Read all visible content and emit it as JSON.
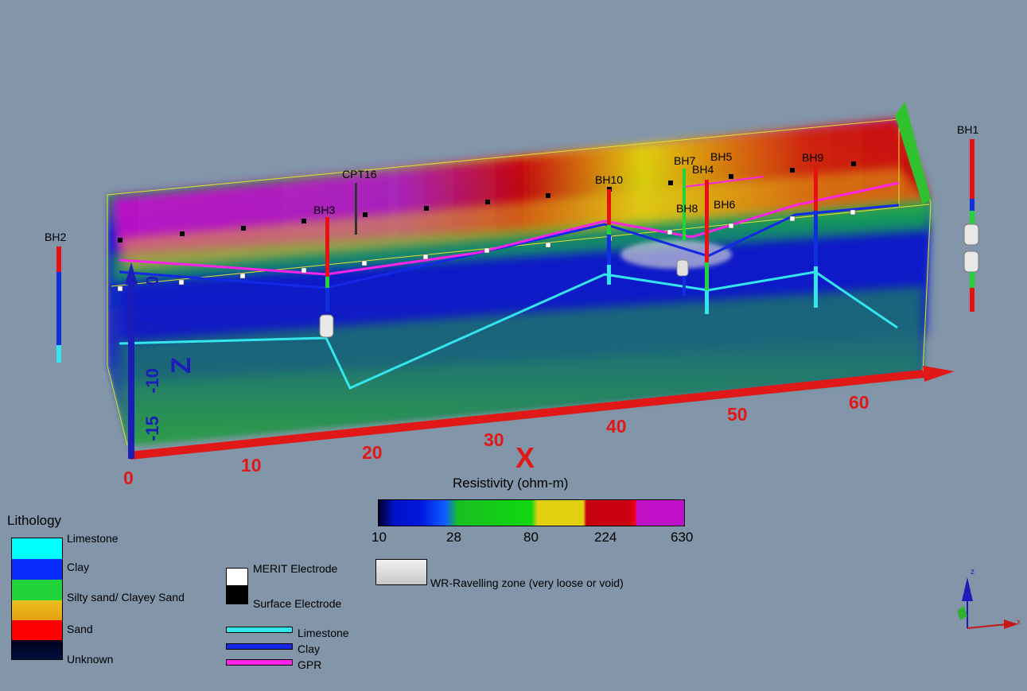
{
  "scene": {
    "boreholes": [
      "BH1",
      "BH2",
      "BH3",
      "BH4",
      "BH5",
      "BH6",
      "BH7",
      "BH8",
      "BH9",
      "BH10",
      "CPT16"
    ],
    "x_axis": {
      "title": "X",
      "ticks": [
        "0",
        "10",
        "20",
        "30",
        "40",
        "50",
        "60"
      ]
    },
    "z_axis": {
      "title": "Z",
      "ticks": [
        "0",
        "-5",
        "-10",
        "-15"
      ]
    },
    "triad": {
      "x": "x",
      "z": "z"
    },
    "colors": {
      "limestone": "#33e6ee",
      "clay": "#1428e6",
      "gpr": "#ff22e8",
      "x_axis": "#e01818",
      "z_axis": "#1c1cb8"
    }
  },
  "resistivity": {
    "title": "Resistivity (ohm-m)",
    "ticks": [
      "10",
      "28",
      "80",
      "224",
      "630"
    ],
    "colors": [
      "#00002a",
      "#0012c8",
      "#1060ff",
      "#18c020",
      "#10d810",
      "#e0d010",
      "#c80010",
      "#ee0010",
      "#c010c8"
    ]
  },
  "lithology": {
    "title": "Lithology",
    "items": [
      {
        "label": "Limestone",
        "color": "#00ffff"
      },
      {
        "label": "Clay",
        "color": "#0a2cff"
      },
      {
        "label": "Silty sand/ Clayey Sand",
        "color": "#22d43a"
      },
      {
        "label": "Sand",
        "color": "#ff0000"
      },
      {
        "label": "Unknown",
        "color": "#000019"
      }
    ],
    "sand_top_color": "#e8c020"
  },
  "electrodes": {
    "merit": "MERIT Electrode",
    "surface": "Surface Electrode"
  },
  "lines": [
    {
      "label": "Limestone",
      "color": "#33e6ee"
    },
    {
      "label": "Clay",
      "color": "#1428e6"
    },
    {
      "label": "GPR",
      "color": "#ff22e8"
    }
  ],
  "ravelling": {
    "label": "WR-Ravelling zone (very loose or void)"
  }
}
